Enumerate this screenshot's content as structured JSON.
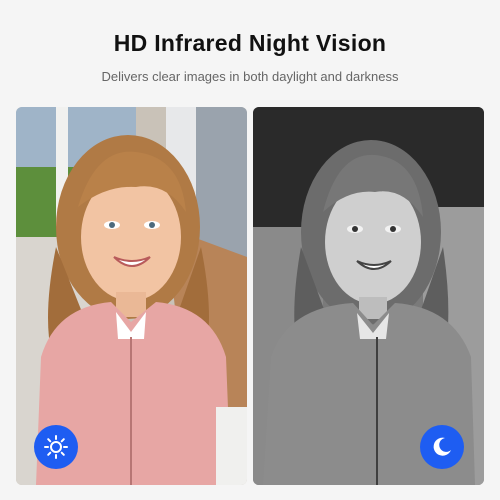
{
  "header": {
    "title": "HD Infrared Night Vision",
    "subtitle": "Delivers clear images in both daylight and darkness"
  },
  "panels": [
    {
      "mode": "day",
      "icon": "sun-icon"
    },
    {
      "mode": "night",
      "icon": "moon-icon"
    }
  ],
  "colors": {
    "accent": "#1e5df2",
    "background": "#f5f5f5"
  }
}
